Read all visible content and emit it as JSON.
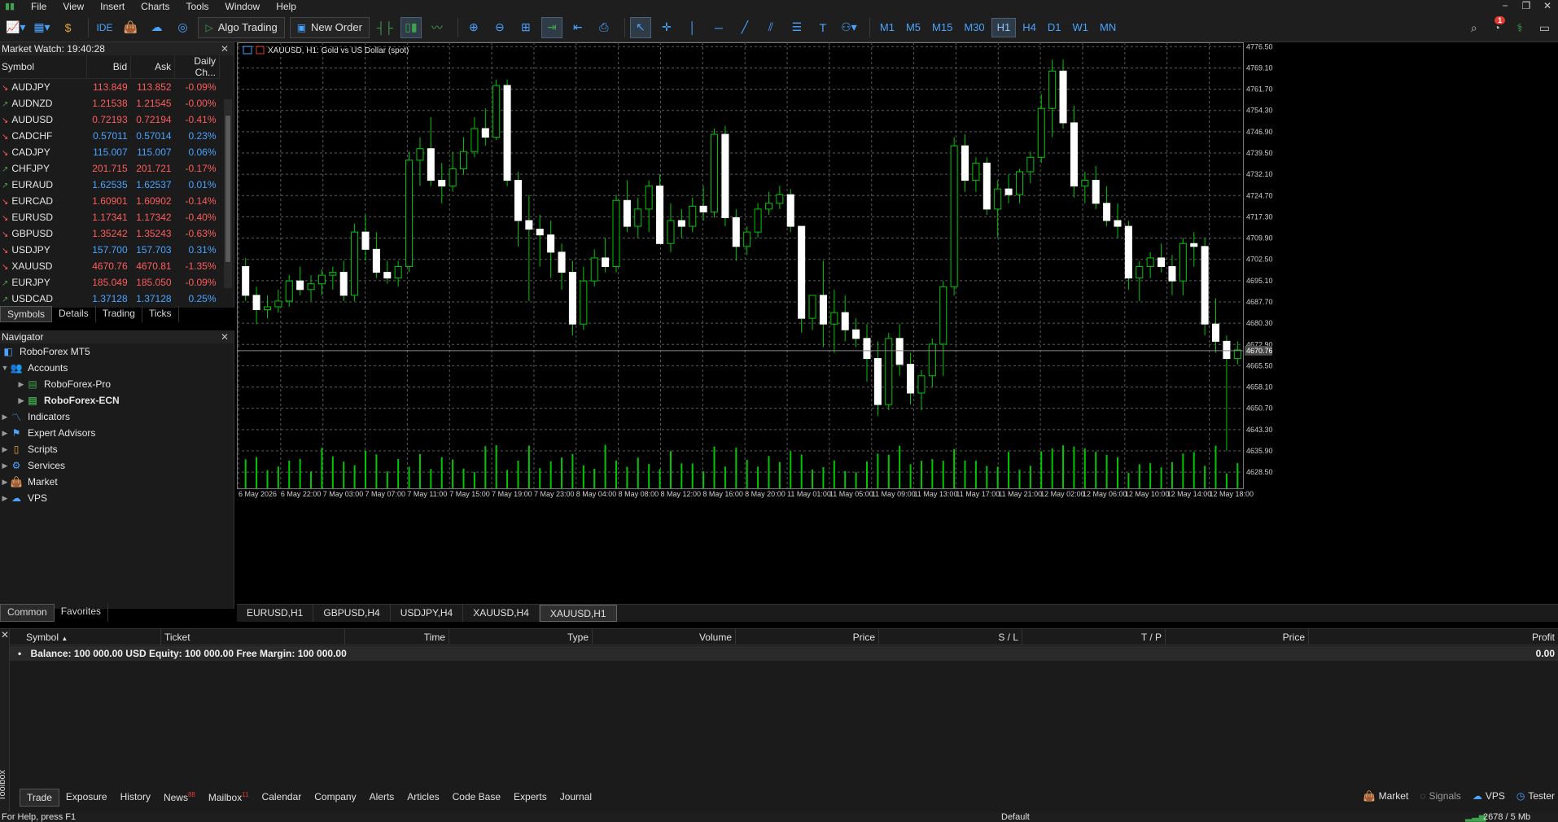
{
  "menu": [
    "File",
    "View",
    "Insert",
    "Charts",
    "Tools",
    "Window",
    "Help"
  ],
  "toolbar": {
    "ide_label": "IDE",
    "algo_trading_label": "Algo Trading",
    "new_order_label": "New Order",
    "timeframes": [
      "M1",
      "M5",
      "M15",
      "M30",
      "H1",
      "H4",
      "D1",
      "W1",
      "MN"
    ],
    "active_timeframe": "H1",
    "notification_count": "1"
  },
  "market_watch": {
    "title": "Market Watch: 19:40:28",
    "columns": [
      "Symbol",
      "Bid",
      "Ask",
      "Daily Ch..."
    ],
    "rows": [
      {
        "symbol": "AUDJPY",
        "bid": "113.849",
        "ask": "113.852",
        "change": "-0.09%",
        "dir": "down"
      },
      {
        "symbol": "AUDNZD",
        "bid": "1.21538",
        "ask": "1.21545",
        "change": "-0.00%",
        "dir": "up"
      },
      {
        "symbol": "AUDUSD",
        "bid": "0.72193",
        "ask": "0.72194",
        "change": "-0.41%",
        "dir": "down"
      },
      {
        "symbol": "CADCHF",
        "bid": "0.57011",
        "ask": "0.57014",
        "change": "0.23%",
        "dir": "down"
      },
      {
        "symbol": "CADJPY",
        "bid": "115.007",
        "ask": "115.007",
        "change": "0.06%",
        "dir": "down"
      },
      {
        "symbol": "CHFJPY",
        "bid": "201.715",
        "ask": "201.721",
        "change": "-0.17%",
        "dir": "up"
      },
      {
        "symbol": "EURAUD",
        "bid": "1.62535",
        "ask": "1.62537",
        "change": "0.01%",
        "dir": "up"
      },
      {
        "symbol": "EURCAD",
        "bid": "1.60901",
        "ask": "1.60902",
        "change": "-0.14%",
        "dir": "down"
      },
      {
        "symbol": "EURUSD",
        "bid": "1.17341",
        "ask": "1.17342",
        "change": "-0.40%",
        "dir": "down"
      },
      {
        "symbol": "GBPUSD",
        "bid": "1.35242",
        "ask": "1.35243",
        "change": "-0.63%",
        "dir": "down"
      },
      {
        "symbol": "USDJPY",
        "bid": "157.700",
        "ask": "157.703",
        "change": "0.31%",
        "dir": "down"
      },
      {
        "symbol": "XAUUSD",
        "bid": "4670.76",
        "ask": "4670.81",
        "change": "-1.35%",
        "dir": "down"
      },
      {
        "symbol": "EURJPY",
        "bid": "185.049",
        "ask": "185.050",
        "change": "-0.09%",
        "dir": "up"
      },
      {
        "symbol": "USDCAD",
        "bid": "1.37128",
        "ask": "1.37128",
        "change": "0.25%",
        "dir": "up"
      }
    ],
    "tabs": [
      "Symbols",
      "Details",
      "Trading",
      "Ticks"
    ],
    "active_tab": "Symbols"
  },
  "navigator": {
    "title": "Navigator",
    "root": "RoboForex MT5",
    "accounts_label": "Accounts",
    "accounts": [
      "RoboForex-Pro",
      "RoboForex-ECN"
    ],
    "items": [
      "Indicators",
      "Expert Advisors",
      "Scripts",
      "Services",
      "Market",
      "VPS"
    ],
    "tabs": [
      "Common",
      "Favorites"
    ],
    "active_tab": "Common"
  },
  "chart": {
    "header": "XAUUSD, H1:  Gold vs US Dollar (spot)",
    "current_price_label": "4670.76",
    "tabs": [
      "EURUSD,H1",
      "GBPUSD,H4",
      "USDJPY,H4",
      "XAUUSD,H4",
      "XAUUSD,H1"
    ],
    "active_tab": "XAUUSD,H1"
  },
  "chart_data": {
    "type": "candlestick",
    "symbol": "XAUUSD",
    "timeframe": "H1",
    "y_ticks": [
      "4776.50",
      "4769.10",
      "4761.70",
      "4754.30",
      "4746.90",
      "4739.50",
      "4732.10",
      "4724.70",
      "4717.30",
      "4709.90",
      "4702.50",
      "4695.10",
      "4687.70",
      "4680.30",
      "4672.90",
      "4665.50",
      "4658.10",
      "4650.70",
      "4643.30",
      "4635.90",
      "4628.50"
    ],
    "x_ticks": [
      "6 May 2026",
      "6 May 22:00",
      "7 May 03:00",
      "7 May 07:00",
      "7 May 11:00",
      "7 May 15:00",
      "7 May 19:00",
      "7 May 23:00",
      "8 May 04:00",
      "8 May 08:00",
      "8 May 12:00",
      "8 May 16:00",
      "8 May 20:00",
      "11 May 01:00",
      "11 May 05:00",
      "11 May 09:00",
      "11 May 13:00",
      "11 May 17:00",
      "11 May 21:00",
      "12 May 02:00",
      "12 May 06:00",
      "12 May 10:00",
      "12 May 14:00",
      "12 May 18:00"
    ],
    "ylim": [
      4624.0,
      4778.0
    ],
    "last_price": 4670.76,
    "candles": [
      [
        4700.0,
        4703.0,
        4688.0,
        4690.0
      ],
      [
        4690.0,
        4693.0,
        4680.0,
        4685.0
      ],
      [
        4685.0,
        4690.0,
        4682.0,
        4686.0
      ],
      [
        4686.0,
        4692.0,
        4684.0,
        4688.0
      ],
      [
        4688.0,
        4697.0,
        4686.0,
        4695.0
      ],
      [
        4695.0,
        4700.0,
        4690.0,
        4692.0
      ],
      [
        4692.0,
        4697.0,
        4688.0,
        4694.0
      ],
      [
        4694.0,
        4699.0,
        4690.0,
        4697.0
      ],
      [
        4697.0,
        4700.0,
        4692.0,
        4698.0
      ],
      [
        4698.0,
        4702.0,
        4688.0,
        4690.0
      ],
      [
        4690.0,
        4715.0,
        4688.0,
        4712.0
      ],
      [
        4712.0,
        4718.0,
        4702.0,
        4706.0
      ],
      [
        4706.0,
        4712.0,
        4696.0,
        4698.0
      ],
      [
        4698.0,
        4702.0,
        4694.0,
        4696.0
      ],
      [
        4696.0,
        4702.0,
        4693.0,
        4700.0
      ],
      [
        4700.0,
        4740.0,
        4698.0,
        4737.0
      ],
      [
        4737.0,
        4745.0,
        4728.0,
        4741.0
      ],
      [
        4741.0,
        4752.0,
        4728.0,
        4730.0
      ],
      [
        4730.0,
        4736.0,
        4722.0,
        4728.0
      ],
      [
        4728.0,
        4740.0,
        4726.0,
        4734.0
      ],
      [
        4734.0,
        4745.0,
        4732.0,
        4740.0
      ],
      [
        4740.0,
        4752.0,
        4738.0,
        4748.0
      ],
      [
        4748.0,
        4755.0,
        4742.0,
        4745.0
      ],
      [
        4745.0,
        4765.0,
        4744.0,
        4763.0
      ],
      [
        4763.0,
        4765.0,
        4728.0,
        4730.0
      ],
      [
        4730.0,
        4733.0,
        4707.0,
        4716.0
      ],
      [
        4716.0,
        4725.0,
        4688.0,
        4713.0
      ],
      [
        4713.0,
        4718.0,
        4700.0,
        4711.0
      ],
      [
        4711.0,
        4716.0,
        4696.0,
        4705.0
      ],
      [
        4705.0,
        4708.0,
        4692.0,
        4698.0
      ],
      [
        4698.0,
        4702.0,
        4676.0,
        4680.0
      ],
      [
        4680.0,
        4700.0,
        4678.0,
        4695.0
      ],
      [
        4695.0,
        4706.0,
        4693.0,
        4703.0
      ],
      [
        4703.0,
        4710.0,
        4698.0,
        4700.0
      ],
      [
        4700.0,
        4725.0,
        4698.0,
        4723.0
      ],
      [
        4723.0,
        4730.0,
        4712.0,
        4714.0
      ],
      [
        4714.0,
        4724.0,
        4710.0,
        4720.0
      ],
      [
        4720.0,
        4730.0,
        4712.0,
        4728.0
      ],
      [
        4728.0,
        4732.0,
        4712.0,
        4708.0
      ],
      [
        4708.0,
        4722.0,
        4705.0,
        4716.0
      ],
      [
        4716.0,
        4720.0,
        4710.0,
        4714.0
      ],
      [
        4714.0,
        4724.0,
        4712.0,
        4721.0
      ],
      [
        4721.0,
        4728.0,
        4716.0,
        4719.0
      ],
      [
        4719.0,
        4748.0,
        4717.0,
        4746.0
      ],
      [
        4746.0,
        4749.0,
        4714.0,
        4717.0
      ],
      [
        4717.0,
        4720.0,
        4702.0,
        4707.0
      ],
      [
        4707.0,
        4714.0,
        4704.0,
        4712.0
      ],
      [
        4712.0,
        4722.0,
        4710.0,
        4720.0
      ],
      [
        4720.0,
        4726.0,
        4718.0,
        4722.0
      ],
      [
        4722.0,
        4728.0,
        4720.0,
        4725.0
      ],
      [
        4725.0,
        4727.0,
        4712.0,
        4714.0
      ],
      [
        4714.0,
        4700.0,
        4677.0,
        4682.0
      ],
      [
        4682.0,
        4690.0,
        4678.0,
        4690.0
      ],
      [
        4690.0,
        4702.0,
        4672.0,
        4680.0
      ],
      [
        4680.0,
        4692.0,
        4670.0,
        4684.0
      ],
      [
        4684.0,
        4690.0,
        4674.0,
        4678.0
      ],
      [
        4678.0,
        4682.0,
        4672.0,
        4675.0
      ],
      [
        4675.0,
        4680.0,
        4660.0,
        4668.0
      ],
      [
        4668.0,
        4674.0,
        4648.0,
        4652.0
      ],
      [
        4652.0,
        4677.0,
        4650.0,
        4675.0
      ],
      [
        4675.0,
        4680.0,
        4662.0,
        4666.0
      ],
      [
        4666.0,
        4670.0,
        4652.0,
        4656.0
      ],
      [
        4656.0,
        4664.0,
        4650.0,
        4662.0
      ],
      [
        4662.0,
        4675.0,
        4658.0,
        4673.0
      ],
      [
        4673.0,
        4695.0,
        4662.0,
        4693.0
      ],
      [
        4693.0,
        4745.0,
        4690.0,
        4742.0
      ],
      [
        4742.0,
        4746.0,
        4726.0,
        4730.0
      ],
      [
        4730.0,
        4738.0,
        4726.0,
        4736.0
      ],
      [
        4736.0,
        4738.0,
        4718.0,
        4720.0
      ],
      [
        4720.0,
        4730.0,
        4710.0,
        4727.0
      ],
      [
        4727.0,
        4732.0,
        4722.0,
        4725.0
      ],
      [
        4725.0,
        4734.0,
        4722.0,
        4733.0
      ],
      [
        4733.0,
        4740.0,
        4729.0,
        4738.0
      ],
      [
        4738.0,
        4760.0,
        4736.0,
        4755.0
      ],
      [
        4755.0,
        4772.0,
        4745.0,
        4768.0
      ],
      [
        4768.0,
        4772.0,
        4748.0,
        4750.0
      ],
      [
        4750.0,
        4756.0,
        4724.0,
        4728.0
      ],
      [
        4728.0,
        4733.0,
        4722.0,
        4730.0
      ],
      [
        4730.0,
        4735.0,
        4720.0,
        4722.0
      ],
      [
        4722.0,
        4728.0,
        4714.0,
        4716.0
      ],
      [
        4716.0,
        4722.0,
        4710.0,
        4714.0
      ],
      [
        4714.0,
        4716.0,
        4692.0,
        4696.0
      ],
      [
        4696.0,
        4702.0,
        4688.0,
        4700.0
      ],
      [
        4700.0,
        4705.0,
        4696.0,
        4703.0
      ],
      [
        4703.0,
        4708.0,
        4698.0,
        4700.0
      ],
      [
        4700.0,
        4704.0,
        4690.0,
        4695.0
      ],
      [
        4695.0,
        4710.0,
        4690.0,
        4708.0
      ],
      [
        4708.0,
        4712.0,
        4700.0,
        4707.0
      ],
      [
        4707.0,
        4710.0,
        4676.0,
        4680.0
      ],
      [
        4680.0,
        4689.0,
        4670.0,
        4674.0
      ],
      [
        4674.0,
        4676.0,
        4636.0,
        4668.0
      ],
      [
        4668.0,
        4674.0,
        4666.0,
        4671.0
      ]
    ]
  },
  "toolbox": {
    "side_label": "Toolbox",
    "columns": [
      "Symbol",
      "Ticket",
      "Time",
      "Type",
      "Volume",
      "Price",
      "S / L",
      "T / P",
      "Price",
      "Profit"
    ],
    "balance_text": "Balance: 100 000.00 USD  Equity: 100 000.00  Free Margin: 100 000.00",
    "profit_total": "0.00",
    "tabs": [
      {
        "label": "Trade",
        "badge": ""
      },
      {
        "label": "Exposure",
        "badge": ""
      },
      {
        "label": "History",
        "badge": ""
      },
      {
        "label": "News",
        "badge": "88"
      },
      {
        "label": "Mailbox",
        "badge": "11"
      },
      {
        "label": "Calendar",
        "badge": ""
      },
      {
        "label": "Company",
        "badge": ""
      },
      {
        "label": "Alerts",
        "badge": ""
      },
      {
        "label": "Articles",
        "badge": ""
      },
      {
        "label": "Code Base",
        "badge": ""
      },
      {
        "label": "Experts",
        "badge": ""
      },
      {
        "label": "Journal",
        "badge": ""
      }
    ],
    "active_tab": "Trade",
    "right_tabs": [
      "Market",
      "Signals",
      "VPS",
      "Tester"
    ]
  },
  "statusbar": {
    "help": "For Help, press F1",
    "profile": "Default",
    "traffic": "2678 / 5 Mb"
  },
  "colors": {
    "bull_body": "#000000",
    "bear_body": "#ffffff",
    "wick": "#00c800",
    "volume": "#00c800",
    "grid": "#5a5a5a",
    "neg_change": "#ff5c5c",
    "pos_change": "#4aa3ff"
  }
}
